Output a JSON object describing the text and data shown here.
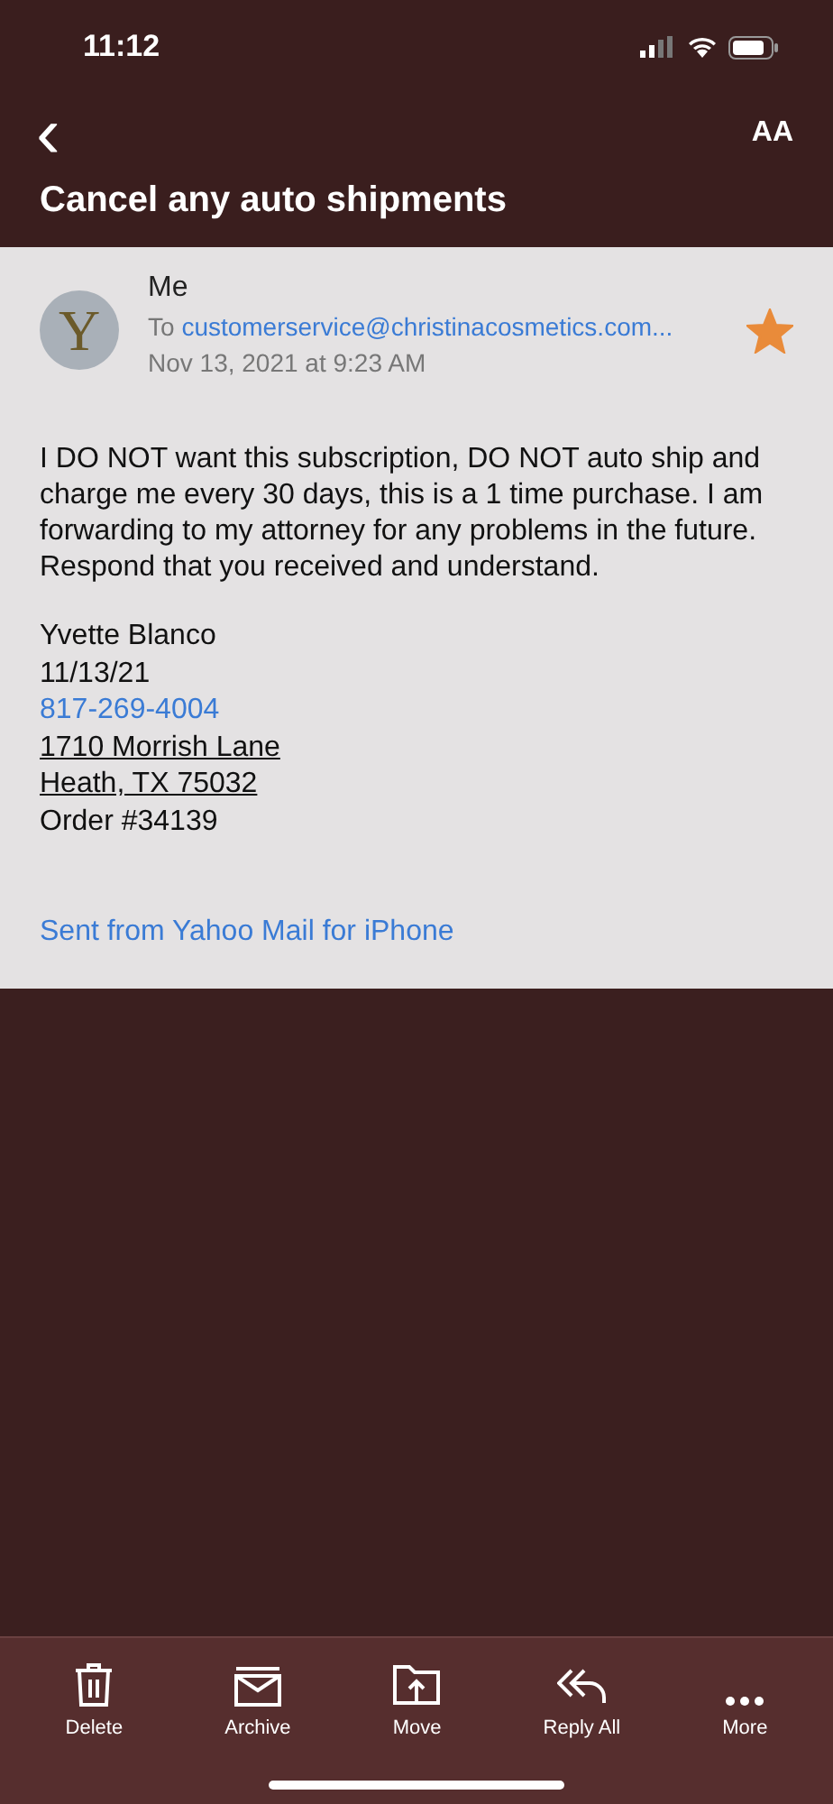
{
  "status_bar": {
    "time": "11:12"
  },
  "nav": {
    "back_icon": "‹",
    "text_size_button": "AA"
  },
  "title": "Cancel any auto shipments",
  "message": {
    "avatar_letter": "Y",
    "sender": "Me",
    "to_label": "To",
    "to": "customerservice@christinacosmetics.com...",
    "date": "Nov 13, 2021 at 9:23 AM",
    "starred": true,
    "body": "I DO NOT want this subscription, DO NOT auto ship and charge me every 30 days, this is a 1 time purchase.  I am forwarding to my attorney for any problems in the future.  Respond that you received and understand.",
    "signature": [
      {
        "kind": "plain",
        "text": "Yvette Blanco"
      },
      {
        "kind": "plain",
        "text": "11/13/21"
      },
      {
        "kind": "link",
        "text": "817-269-4004"
      },
      {
        "kind": "underlined",
        "text": "1710 Morrish Lane"
      },
      {
        "kind": "underlined",
        "text": "Heath, TX 75032"
      },
      {
        "kind": "plain",
        "text": "Order #34139"
      }
    ],
    "footer_link": "Sent from Yahoo Mail for iPhone"
  },
  "toolbar": [
    {
      "kind": "delete",
      "label": "Delete"
    },
    {
      "kind": "archive",
      "label": "Archive"
    },
    {
      "kind": "move",
      "label": "Move"
    },
    {
      "kind": "reply_all",
      "label": "Reply All"
    },
    {
      "kind": "more",
      "label": "More"
    }
  ]
}
